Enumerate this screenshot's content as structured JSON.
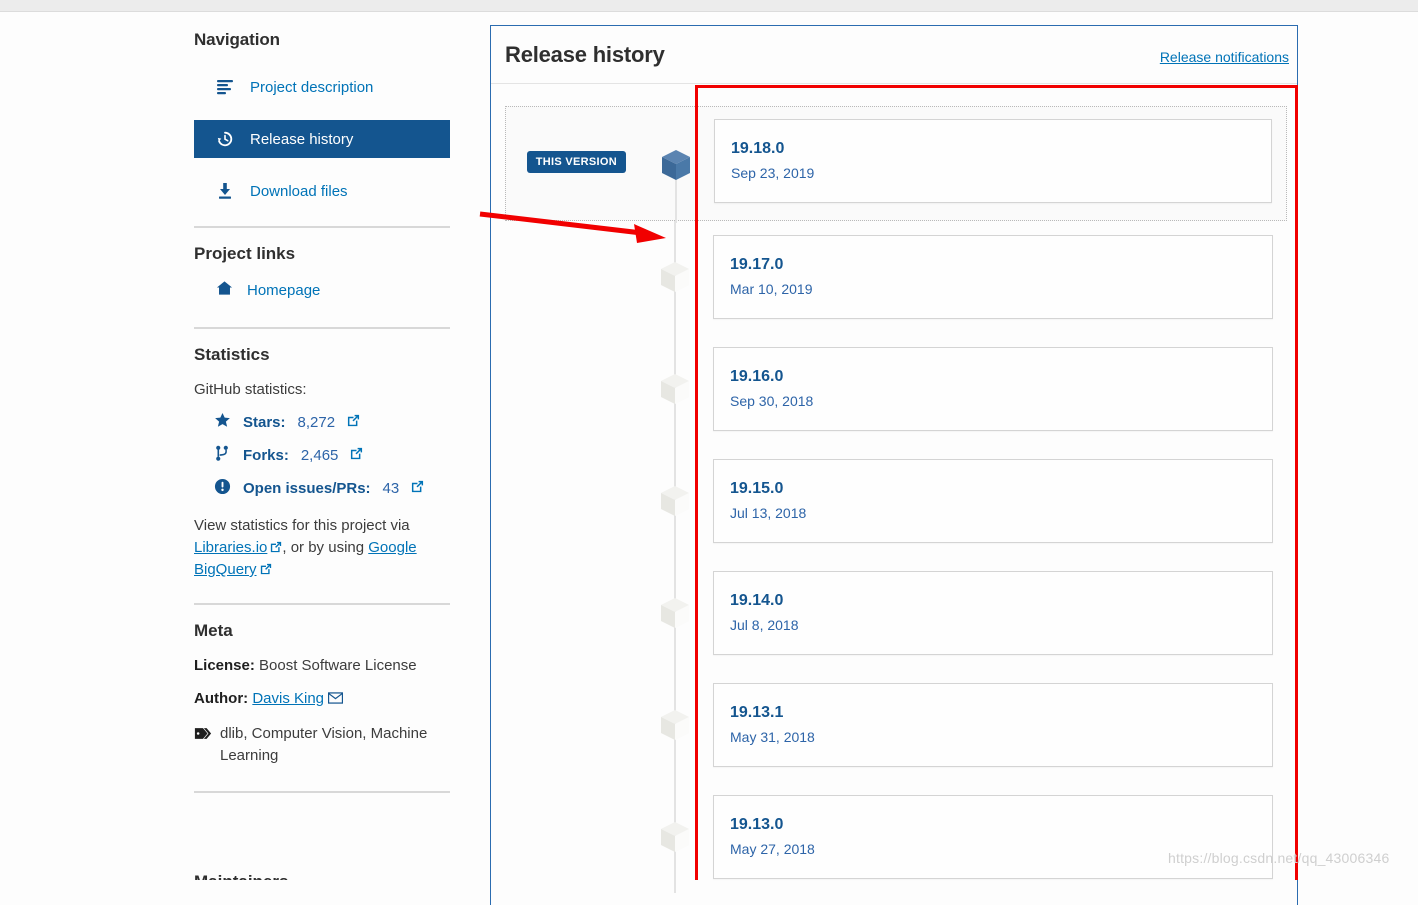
{
  "sidebar": {
    "navigation_title": "Navigation",
    "nav_items": [
      {
        "label": "Project description",
        "icon": "list-icon",
        "active": false
      },
      {
        "label": "Release history",
        "icon": "history-icon",
        "active": true
      },
      {
        "label": "Download files",
        "icon": "download-icon",
        "active": false
      }
    ],
    "project_links_title": "Project links",
    "project_links": [
      {
        "label": "Homepage",
        "icon": "home-icon"
      }
    ],
    "statistics_title": "Statistics",
    "github_statistics_label": "GitHub statistics:",
    "stats": [
      {
        "icon": "star-icon",
        "label": "Stars:",
        "value": "8,272"
      },
      {
        "icon": "fork-icon",
        "label": "Forks:",
        "value": "2,465"
      },
      {
        "icon": "issue-icon",
        "label": "Open issues/PRs:",
        "value": "43"
      }
    ],
    "stats_note_prefix": "View statistics for this project via ",
    "stats_note_link1": "Libraries.io",
    "stats_note_middle": ", or by using ",
    "stats_note_link2": "Google BigQuery",
    "meta_title": "Meta",
    "license_label": "License:",
    "license_value": "Boost Software License",
    "author_label": "Author:",
    "author_value": "Davis King",
    "tags": "dlib, Computer Vision, Machine Learning",
    "maintainers_title": "Maintainers"
  },
  "main": {
    "title": "Release history",
    "release_notifications": "Release notifications",
    "this_version_badge": "THIS VERSION",
    "releases": [
      {
        "version": "19.18.0",
        "date": "Sep 23, 2019",
        "current": true
      },
      {
        "version": "19.17.0",
        "date": "Mar 10, 2019",
        "current": false
      },
      {
        "version": "19.16.0",
        "date": "Sep 30, 2018",
        "current": false
      },
      {
        "version": "19.15.0",
        "date": "Jul 13, 2018",
        "current": false
      },
      {
        "version": "19.14.0",
        "date": "Jul 8, 2018",
        "current": false
      },
      {
        "version": "19.13.1",
        "date": "May 31, 2018",
        "current": false
      },
      {
        "version": "19.13.0",
        "date": "May 27, 2018",
        "current": false
      }
    ]
  },
  "annotations": {
    "watermark": "https://blog.csdn.net/qq_43006346",
    "highlight_color": "#f10000"
  },
  "colors": {
    "brand_blue": "#14558f",
    "link_blue": "#0073b7",
    "panel_border": "#2b6cb0"
  }
}
